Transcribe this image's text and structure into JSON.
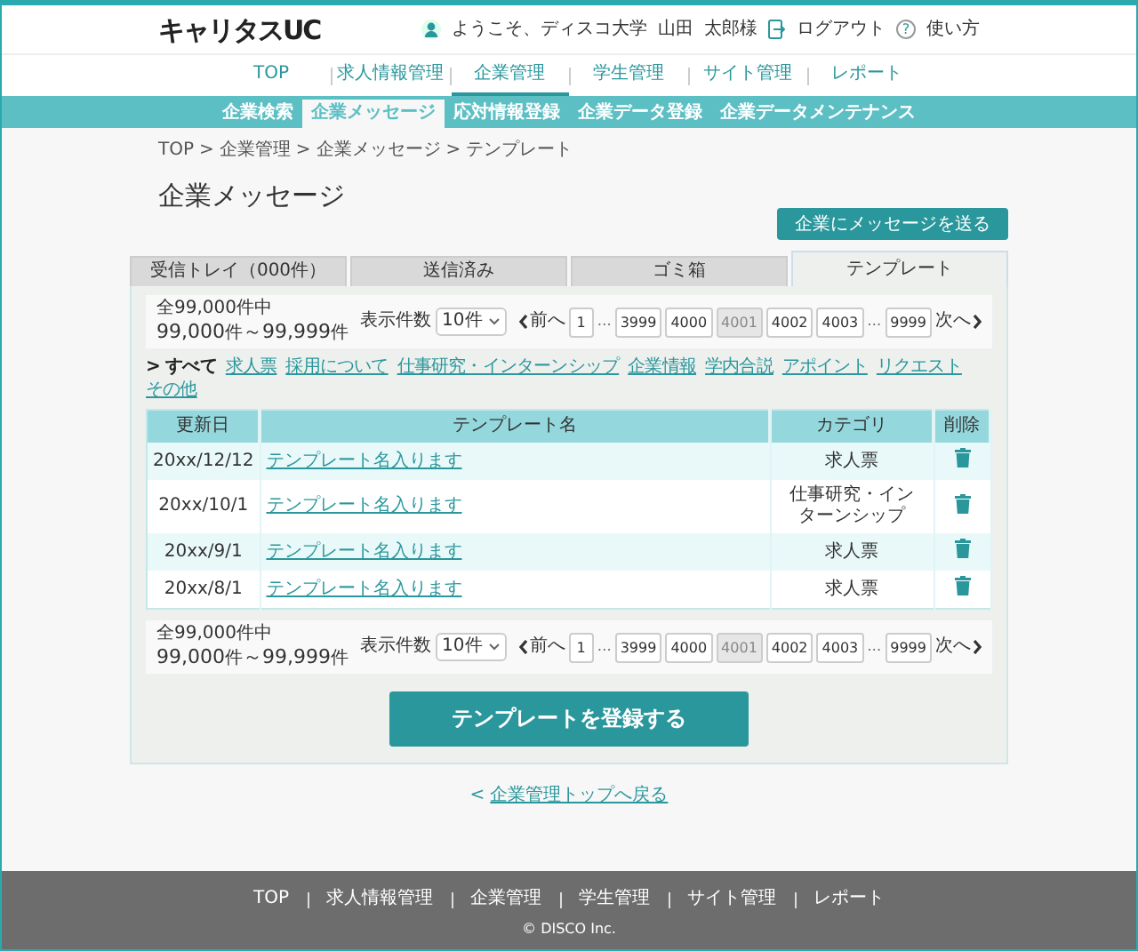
{
  "header": {
    "logo": "キャリタスUC",
    "welcome": "ようこそ、ディスコ大学",
    "user_family_name": "山田",
    "user_given_name": "太郎様",
    "logout": "ログアウト",
    "help_icon_glyph": "?",
    "help": "使い方"
  },
  "main_nav": [
    {
      "label": "TOP",
      "selected": false
    },
    {
      "label": "求人情報管理",
      "selected": false
    },
    {
      "label": "企業管理",
      "selected": true
    },
    {
      "label": "学生管理",
      "selected": false
    },
    {
      "label": "サイト管理",
      "selected": false
    },
    {
      "label": "レポート",
      "selected": false
    }
  ],
  "sub_nav": [
    {
      "label": "企業検索",
      "selected": false
    },
    {
      "label": "企業メッセージ",
      "selected": true
    },
    {
      "label": "応対情報登録",
      "selected": false
    },
    {
      "label": "企業データ登録",
      "selected": false
    },
    {
      "label": "企業データメンテナンス",
      "selected": false
    }
  ],
  "breadcrumb": {
    "separator": ">",
    "items": [
      "TOP",
      "企業管理",
      "企業メッセージ",
      "テンプレート"
    ]
  },
  "page_title": "企業メッセージ",
  "send_button": "企業にメッセージを送る",
  "tabs": [
    {
      "label": "受信トレイ（000件）",
      "selected": false
    },
    {
      "label": "送信済み",
      "selected": false
    },
    {
      "label": "ゴミ箱",
      "selected": false
    },
    {
      "label": "テンプレート",
      "selected": true
    }
  ],
  "pagers": [
    {
      "total": "全99,000件中",
      "range_from": "99,000",
      "range_to": "99,999",
      "unit_from": "件",
      "unit_to": "件",
      "range_separator": "～",
      "per_page_label": "表示件数",
      "per_page": "10件",
      "prev": "前へ",
      "next": "次へ",
      "pages": [
        {
          "kind": "page",
          "label": "1",
          "selected": false
        },
        {
          "kind": "ellipsis",
          "label": "…"
        },
        {
          "kind": "page",
          "label": "3999",
          "selected": false
        },
        {
          "kind": "page",
          "label": "4000",
          "selected": false
        },
        {
          "kind": "page",
          "label": "4001",
          "selected": true
        },
        {
          "kind": "page",
          "label": "4002",
          "selected": false
        },
        {
          "kind": "page",
          "label": "4003",
          "selected": false
        },
        {
          "kind": "ellipsis",
          "label": "…"
        },
        {
          "kind": "page",
          "label": "9999",
          "selected": false
        }
      ]
    },
    {
      "total": "全99,000件中",
      "range_from": "99,000",
      "range_to": "99,999",
      "unit_from": "件",
      "unit_to": "件",
      "range_separator": "～",
      "per_page_label": "表示件数",
      "per_page": "10件",
      "prev": "前へ",
      "next": "次へ",
      "pages": [
        {
          "kind": "page",
          "label": "1",
          "selected": false
        },
        {
          "kind": "ellipsis",
          "label": "…"
        },
        {
          "kind": "page",
          "label": "3999",
          "selected": false
        },
        {
          "kind": "page",
          "label": "4000",
          "selected": false
        },
        {
          "kind": "page",
          "label": "4001",
          "selected": true
        },
        {
          "kind": "page",
          "label": "4002",
          "selected": false
        },
        {
          "kind": "page",
          "label": "4003",
          "selected": false
        },
        {
          "kind": "ellipsis",
          "label": "…"
        },
        {
          "kind": "page",
          "label": "9999",
          "selected": false
        }
      ]
    }
  ],
  "filters": {
    "marker": ">",
    "items": [
      {
        "label": "すべて",
        "selected": true
      },
      {
        "label": "求人票",
        "selected": false
      },
      {
        "label": "採用について",
        "selected": false
      },
      {
        "label": "仕事研究・インターンシップ",
        "selected": false
      },
      {
        "label": "企業情報",
        "selected": false
      },
      {
        "label": "学内合説",
        "selected": false
      },
      {
        "label": "アポイント",
        "selected": false
      },
      {
        "label": "リクエスト",
        "selected": false
      },
      {
        "label": "その他",
        "selected": false
      }
    ]
  },
  "table": {
    "columns": [
      "更新日",
      "テンプレート名",
      "カテゴリ",
      "削除"
    ],
    "rows": [
      {
        "date": "20xx/12/12",
        "name": "テンプレート名入ります",
        "category": "求人票"
      },
      {
        "date": "20xx/10/1",
        "name": "テンプレート名入ります",
        "category": "仕事研究・インターンシップ"
      },
      {
        "date": "20xx/9/1",
        "name": "テンプレート名入ります",
        "category": "求人票"
      },
      {
        "date": "20xx/8/1",
        "name": "テンプレート名入ります",
        "category": "求人票"
      }
    ]
  },
  "register_button": "テンプレートを登録する",
  "back_link": {
    "arrow": "<",
    "label": "企業管理トップへ戻る"
  },
  "footer": {
    "links": [
      "TOP",
      "求人情報管理",
      "企業管理",
      "学生管理",
      "サイト管理",
      "レポート"
    ],
    "copyright": "© DISCO Inc."
  }
}
